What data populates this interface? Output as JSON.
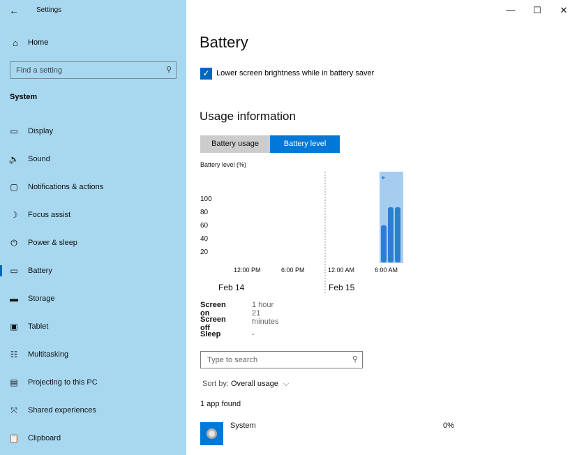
{
  "window": {
    "title": "Settings",
    "back_glyph": "←",
    "minimize_glyph": "—",
    "maximize_glyph": "☐",
    "close_glyph": "✕"
  },
  "sidebar": {
    "home_label": "Home",
    "search_placeholder": "Find a setting",
    "section_label": "System",
    "items": [
      {
        "label": "Display",
        "icon": "display-icon",
        "glyph": "▭",
        "active": false
      },
      {
        "label": "Sound",
        "icon": "sound-icon",
        "glyph": "🔈",
        "active": false
      },
      {
        "label": "Notifications & actions",
        "icon": "notifications-icon",
        "glyph": "▢",
        "active": false
      },
      {
        "label": "Focus assist",
        "icon": "moon-icon",
        "glyph": "☽",
        "active": false
      },
      {
        "label": "Power & sleep",
        "icon": "power-icon",
        "glyph": "⏻",
        "active": false
      },
      {
        "label": "Battery",
        "icon": "battery-icon",
        "glyph": "▭",
        "active": true
      },
      {
        "label": "Storage",
        "icon": "storage-icon",
        "glyph": "▬",
        "active": false
      },
      {
        "label": "Tablet",
        "icon": "tablet-icon",
        "glyph": "▣",
        "active": false
      },
      {
        "label": "Multitasking",
        "icon": "multitasking-icon",
        "glyph": "☷",
        "active": false
      },
      {
        "label": "Projecting to this PC",
        "icon": "projecting-icon",
        "glyph": "▤",
        "active": false
      },
      {
        "label": "Shared experiences",
        "icon": "shared-experiences-icon",
        "glyph": "⤧",
        "active": false
      },
      {
        "label": "Clipboard",
        "icon": "clipboard-icon",
        "glyph": "📋",
        "active": false
      }
    ]
  },
  "main": {
    "title": "Battery",
    "checkbox_label": "Lower screen brightness while in battery saver",
    "checkbox_checked": true,
    "usage_heading": "Usage information",
    "tabs": [
      {
        "label": "Battery usage",
        "active": false
      },
      {
        "label": "Battery level",
        "active": true
      }
    ],
    "chart_ylabel": "Battery level (%)",
    "stats": [
      {
        "label": "Screen on",
        "value": "1 hour 21 minutes"
      },
      {
        "label": "Screen off",
        "value": "-"
      },
      {
        "label": "Sleep",
        "value": "-"
      }
    ],
    "app_search_placeholder": "Type to search",
    "sort_prefix": "Sort by:",
    "sort_value": "Overall usage",
    "found_text": "1 app found",
    "apps": [
      {
        "name": "System",
        "percent": "0%"
      }
    ]
  },
  "chart_data": {
    "type": "bar",
    "ylabel": "Battery level (%)",
    "yticks": [
      "100",
      "80",
      "60",
      "40",
      "20"
    ],
    "ylim": [
      0,
      110
    ],
    "x_tick_labels": [
      "12:00 PM",
      "6:00 PM",
      "12:00 AM",
      "6:00 AM"
    ],
    "date_labels": [
      "Feb 14",
      "Feb 15"
    ],
    "values": [
      58,
      86,
      86
    ],
    "bar_color": "#2a7fd4",
    "highlight_color": "#a6cdf0",
    "charging_icon": "plug-icon"
  }
}
